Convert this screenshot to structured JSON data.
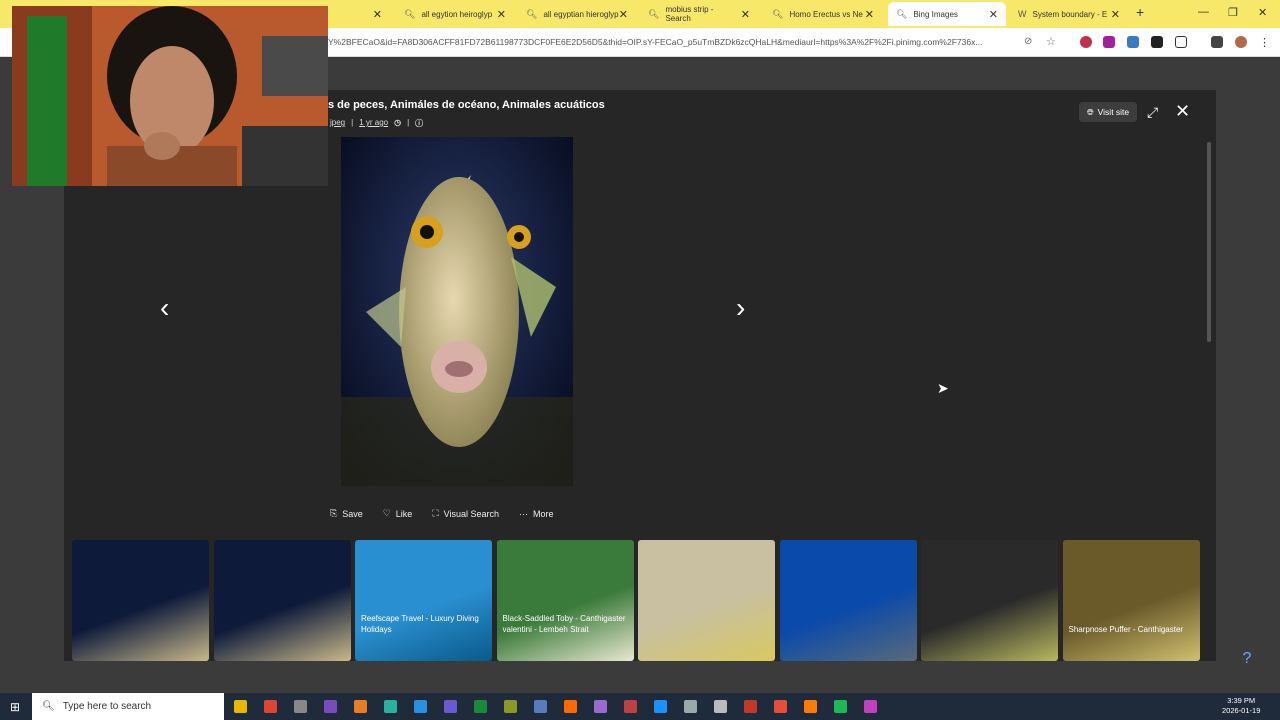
{
  "tabs": [
    {
      "label": "all egytion heiroglyp",
      "icon": "search-icon"
    },
    {
      "label": "all egyptian hieroglyp",
      "icon": "search-icon"
    },
    {
      "label": "mobius strip - Search",
      "icon": "search-icon"
    },
    {
      "label": "Homo Erectus vs Ne",
      "icon": "search-icon"
    },
    {
      "label": "Bing Images",
      "icon": "search-icon"
    },
    {
      "label": "System boundary - E",
      "icon": "wikipedia-icon"
    }
  ],
  "address": {
    "url": "Y%2BFECaO&id=FA8D306ACFF81FD72B61198773DCF0FE6E2D56D5&thid=OIP.sY-FECaO_p5uTmBZDk6zcQHaLH&mediaurl=https%3A%2F%2Fi.pinimg.com%2F736x..."
  },
  "viewer": {
    "title": "s de peces, Animáles de océano, Animales acuáticos",
    "meta_source": "jpeg",
    "meta_time": "1 yr ago",
    "visit_label": "Visit site"
  },
  "actions": {
    "save": "Save",
    "like": "Like",
    "visual_search": "Visual Search",
    "more": "More"
  },
  "thumbs": [
    {
      "caption": "",
      "colors": [
        "#0d1a3a",
        "#c9b98a"
      ]
    },
    {
      "caption": "",
      "colors": [
        "#0d1a3a",
        "#c9b98a"
      ]
    },
    {
      "caption": "Reefscape Travel - Luxury Diving Holidays",
      "colors": [
        "#2a8fd0",
        "#0a5a8a"
      ]
    },
    {
      "caption": "Black-Saddled Toby - Canthigaster valentini - Lembeh Strait",
      "colors": [
        "#3a7a3a",
        "#e8e8d0"
      ]
    },
    {
      "caption": "",
      "colors": [
        "#c8c0a0",
        "#d8c860"
      ]
    },
    {
      "caption": "",
      "colors": [
        "#0a4aaa",
        "#5a6a7a"
      ]
    },
    {
      "caption": "",
      "colors": [
        "#2a2a2a",
        "#b8b860"
      ]
    },
    {
      "caption": "Sharpnose Puffer - Canthigaster",
      "colors": [
        "#6a5a2a",
        "#d0c070"
      ]
    }
  ],
  "taskbar": {
    "search_placeholder": "Type here to search",
    "time": "3:39 PM",
    "date": "2026-01-19"
  }
}
